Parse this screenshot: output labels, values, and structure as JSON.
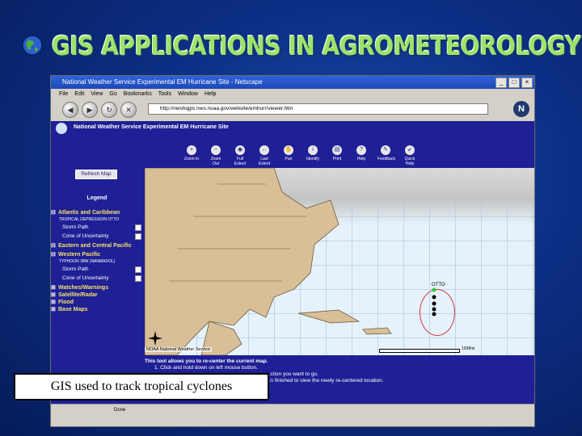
{
  "slide": {
    "title": "GIS APPLICATIONS IN AGROMETEOROLOGY",
    "caption": "GIS used to track tropical cyclones"
  },
  "browser": {
    "window_title": "National Weather Service Experimental EM Hurricane Site - Netscape",
    "menu": [
      "File",
      "Edit",
      "View",
      "Go",
      "Bookmarks",
      "Tools",
      "Window",
      "Help"
    ],
    "url": "http://nwshqgis.nws.noaa.gov/website/emhurr/viewer.htm",
    "status": "Done"
  },
  "site": {
    "header": "National Weather Service Experimental EM Hurricane Site",
    "tools": [
      "Zoom In",
      "Zoom Out",
      "Full Extent",
      "Last Extent",
      "Pan",
      "Identify",
      "Print",
      "Help",
      "Feedback",
      "Quick Help"
    ],
    "refresh_label": "Refresh Map",
    "legend_title": "Legend"
  },
  "legend": {
    "groups": [
      {
        "title": "Atlantic and Caribbean",
        "sub": "TROPICAL DEPRESSION OTTO",
        "layers": [
          "Storm Path",
          "Cone of Uncertainty"
        ]
      },
      {
        "title": "Eastern and Central Pacific"
      },
      {
        "title": "Western Pacific",
        "sub": "TYPHOON 38W (NANMADOL)",
        "layers": [
          "Storm Path",
          "Cone of Uncertainty"
        ]
      },
      {
        "title": "Watches/Warnings"
      },
      {
        "title": "Satellite/Radar"
      },
      {
        "title": "Flood"
      },
      {
        "title": "Base Maps"
      }
    ]
  },
  "map": {
    "storm_label": "OTTO",
    "credit": "NOAA National Weather Service",
    "scale": "1938mi"
  },
  "instructions": {
    "line1": "This tool allows you to re-center the current map.",
    "line2": "1. Click and hold down on left mouse button.",
    "line3": "...ction you want to go.",
    "line4": "...n finished to view the newly re-centered location."
  },
  "colors": {
    "slide_title": "#9be36a",
    "site_bg": "#1f1f96",
    "legend_group": "#f4e26a"
  }
}
